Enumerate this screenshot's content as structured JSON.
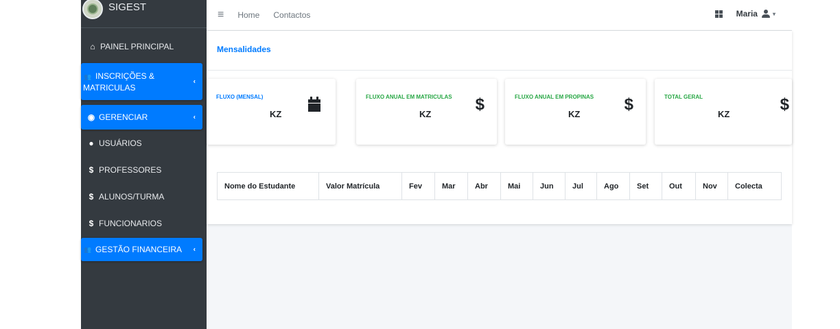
{
  "brand": {
    "name": "SIGEST",
    "logo_icon": "school-seal-icon"
  },
  "sidebar": {
    "items": [
      {
        "icon": "home-icon",
        "glyph": "⌂",
        "label": "PAINEL PRINCIPAL",
        "active": false
      },
      {
        "icon": "users-icon",
        "glyph": "👥",
        "label_line1": "INSCRIÇÕES &",
        "label_line2": "MATRICULAS",
        "active": true
      },
      {
        "icon": "dashboard-icon",
        "glyph": "◉",
        "label": "GERENCIAR",
        "active": true
      },
      {
        "icon": "user-icon",
        "glyph": "●",
        "label": "USUÁRIOS",
        "active": false
      },
      {
        "icon": "dollar-icon",
        "glyph": "$",
        "label": "PROFESSORES",
        "active": false
      },
      {
        "icon": "dollar-icon",
        "glyph": "$",
        "label": "ALUNOS/TURMA",
        "active": false
      },
      {
        "icon": "dollar-icon",
        "glyph": "$",
        "label": "FUNCIONARIOS",
        "active": false
      },
      {
        "icon": "users-icon",
        "glyph": "👥",
        "label": "GESTÃO FINANCEIRA",
        "active": true
      }
    ],
    "chevron": "‹"
  },
  "header": {
    "menu_glyph": "≡",
    "links": [
      "Home",
      "Contactos"
    ],
    "user_name": "Maria",
    "caret": "▾"
  },
  "page": {
    "title": "Mensalidades",
    "stats": [
      {
        "label": "FLUXO (MENSAL)",
        "value": "KZ",
        "icon": "calendar-icon",
        "label_color": "#007bff"
      },
      {
        "label": "FLUXO ANUAL EM MATRICULAS",
        "value": "KZ",
        "icon": "dollar-icon",
        "glyph": "$",
        "label_color": "#28a745"
      },
      {
        "label": "FLUXO ANUAL EM PROPINAS",
        "value": "KZ",
        "icon": "dollar-icon",
        "glyph": "$",
        "label_color": "#28a745"
      },
      {
        "label": "TOTAL GERAL",
        "value": "KZ",
        "icon": "dollar-icon",
        "glyph": "$",
        "label_color": "#28a745"
      }
    ],
    "table": {
      "columns": [
        "Nome do Estudante",
        "Valor Matrícula",
        "Fev",
        "Mar",
        "Abr",
        "Mai",
        "Jun",
        "Jul",
        "Ago",
        "Set",
        "Out",
        "Nov",
        "Colecta"
      ]
    }
  },
  "colors": {
    "accent": "#007bff",
    "sidebar": "#343a40",
    "success": "#28a745"
  }
}
